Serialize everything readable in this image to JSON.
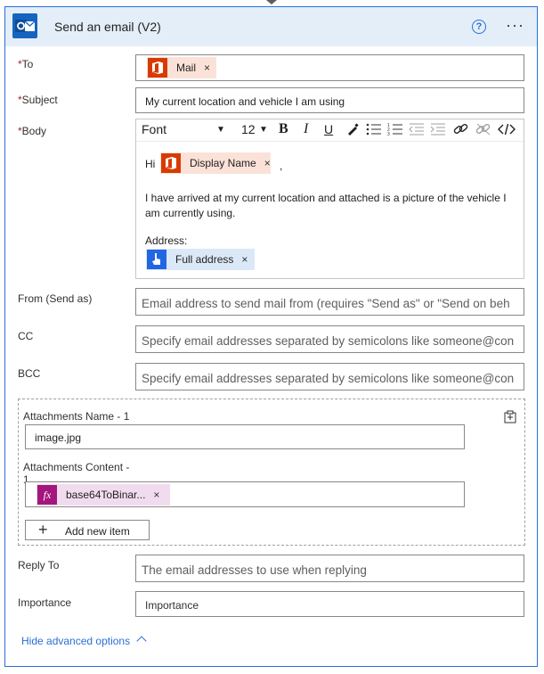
{
  "header": {
    "title": "Send an email (V2)",
    "help_icon": "help-icon",
    "more_icon": "more-icon"
  },
  "fields": {
    "to": {
      "label": "To",
      "token": "Mail"
    },
    "subject": {
      "label": "Subject",
      "value": "My current location and vehicle I am using"
    },
    "body": {
      "label": "Body",
      "toolbar": {
        "font": "Font",
        "size": "12"
      },
      "greeting": "Hi",
      "name_token": "Display Name",
      "after_token": ",",
      "line1": "I have arrived at my current location and attached is a picture of the vehicle I",
      "line2": "am currently using.",
      "address_label": "Address:",
      "address_token": "Full address"
    },
    "from": {
      "label": "From (Send as)",
      "placeholder": "Email address to send mail from (requires \"Send as\" or \"Send on beh"
    },
    "cc": {
      "label": "CC",
      "placeholder": "Specify email addresses separated by semicolons like someone@con"
    },
    "bcc": {
      "label": "BCC",
      "placeholder": "Specify email addresses separated by semicolons like someone@con"
    },
    "attachments": {
      "name_label": "Attachments Name - 1",
      "name_value": "image.jpg",
      "content_label_a": "Attachments Content -",
      "content_label_b": "1",
      "content_token": "base64ToBinar...",
      "add_item": "Add new item"
    },
    "reply_to": {
      "label": "Reply To",
      "placeholder": "The email addresses to use when replying"
    },
    "importance": {
      "label": "Importance",
      "value": "Importance"
    }
  },
  "hide_advanced": "Hide advanced options",
  "required_mark": "*",
  "token_remove": "×",
  "colors": {
    "accent": "#2a6fd6",
    "office": "#d83b01",
    "expression": "#a4167e",
    "location": "#2266e3"
  }
}
